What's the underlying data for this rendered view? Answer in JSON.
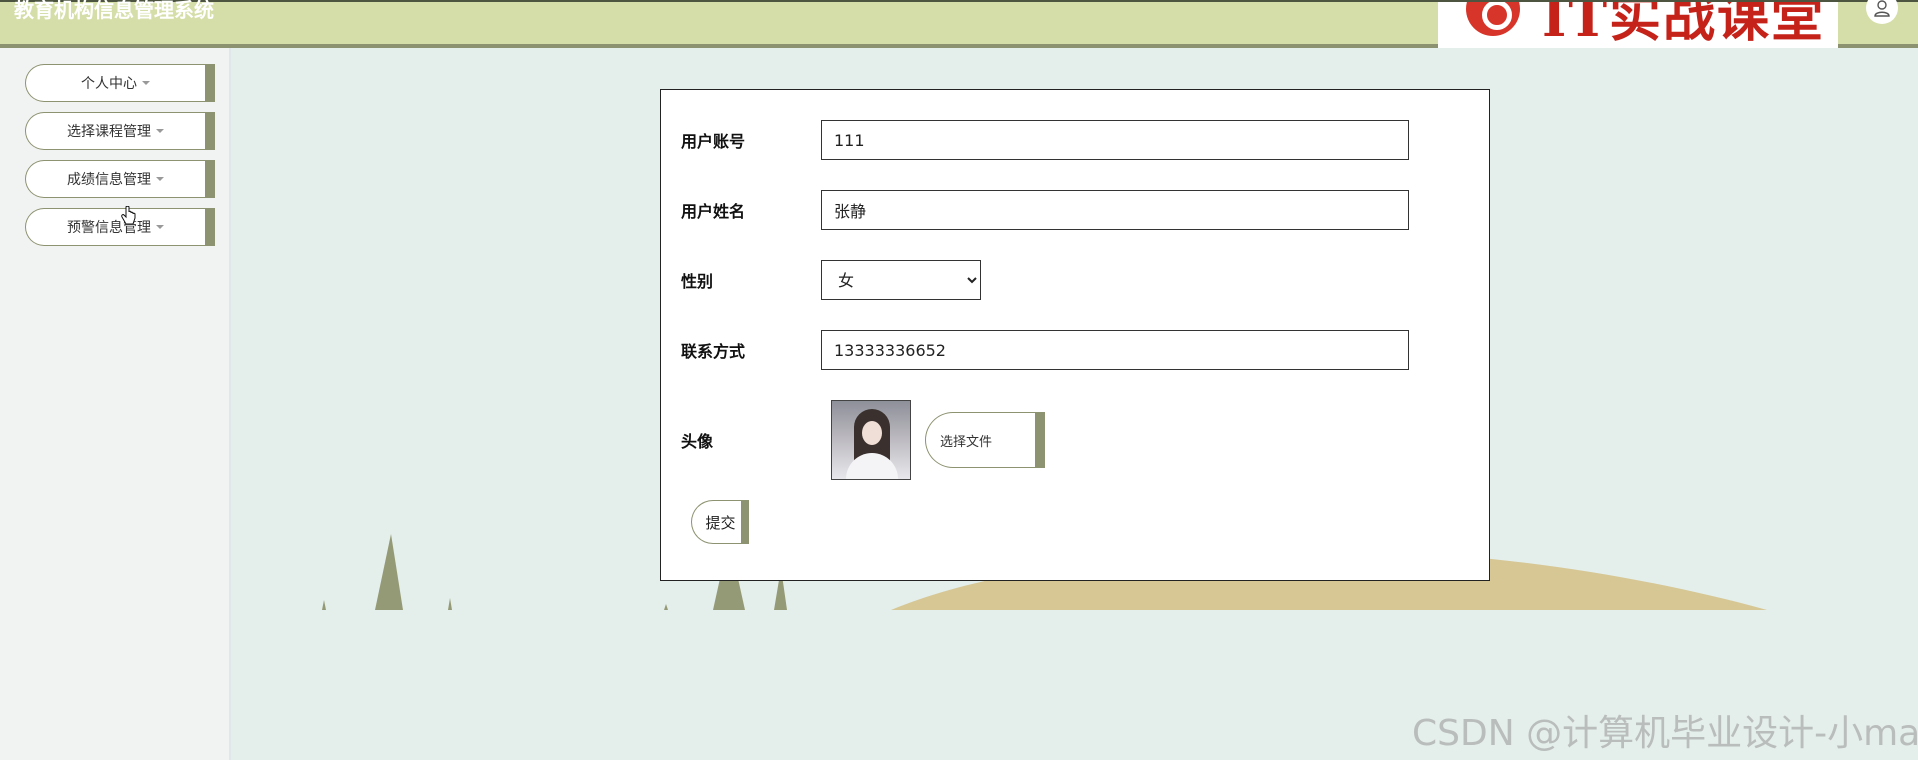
{
  "header": {
    "title": "教育机构信息管理系统",
    "logo_text": "IT实战课堂",
    "icons": {
      "logo": "chrome-style-logo-icon",
      "user": "user-icon"
    }
  },
  "sidebar": {
    "items": [
      {
        "label": "个人中心",
        "icon": "chevron-down-icon"
      },
      {
        "label": "选择课程管理",
        "icon": "chevron-down-icon"
      },
      {
        "label": "成绩信息管理",
        "icon": "chevron-down-icon"
      },
      {
        "label": "预警信息管理",
        "icon": "chevron-down-icon"
      }
    ]
  },
  "form": {
    "fields": {
      "account": {
        "label": "用户账号",
        "value": "111"
      },
      "name": {
        "label": "用户姓名",
        "value": "张静"
      },
      "gender": {
        "label": "性别",
        "value": "女"
      },
      "phone": {
        "label": "联系方式",
        "value": "13333336652"
      },
      "avatar": {
        "label": "头像",
        "file_button_label": "选择文件"
      }
    },
    "submit_label": "提交"
  },
  "colors": {
    "header_bg": "#d5dea8",
    "accent": "#8d9270",
    "main_bg": "#e4eeeb",
    "hill": "#d6c795",
    "tree": "#959a76"
  },
  "watermark": "CSDN @计算机毕业设计-小ma"
}
